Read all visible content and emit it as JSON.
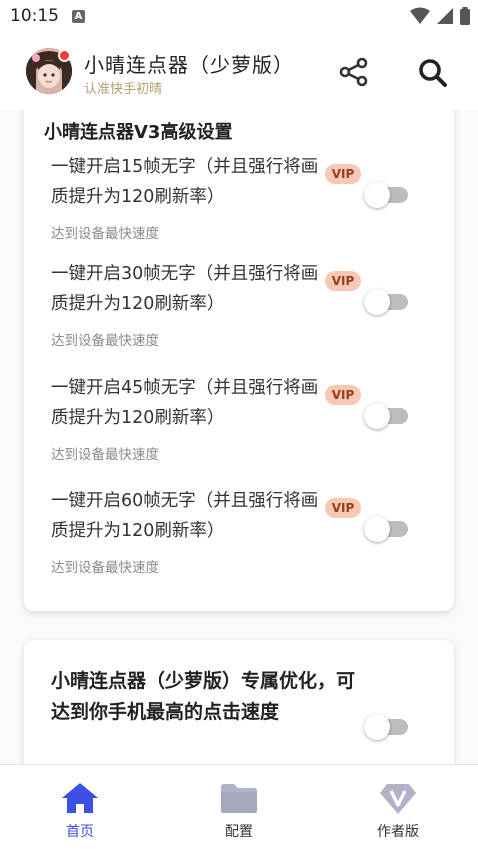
{
  "status_bar": {
    "time": "10:15",
    "notification": "A"
  },
  "header": {
    "title": "小晴连点器（少萝版）",
    "subtitle": "认准快手初晴",
    "share_icon": "share-icon",
    "search_icon": "search-icon"
  },
  "advanced_card": {
    "title": "小晴连点器V3高级设置",
    "options": [
      {
        "label": "一键开启15帧无字（并且强行将画质提升为120刷新率）",
        "sub": "达到设备最快速度",
        "badge": "VIP",
        "enabled": false
      },
      {
        "label": "一键开启30帧无字（并且强行将画质提升为120刷新率）",
        "sub": "达到设备最快速度",
        "badge": "VIP",
        "enabled": false
      },
      {
        "label": "一键开启45帧无字（并且强行将画质提升为120刷新率）",
        "sub": "达到设备最快速度",
        "badge": "VIP",
        "enabled": false
      },
      {
        "label": "一键开启60帧无字（并且强行将画质提升为120刷新率）",
        "sub": "达到设备最快速度",
        "badge": "VIP",
        "enabled": false
      }
    ]
  },
  "optimize_card": {
    "label": "小晴连点器（少萝版）专属优化，可达到你手机最高的点击速度",
    "enabled": false
  },
  "bottom_nav": {
    "items": [
      {
        "label": "首页",
        "icon": "home-icon",
        "active": true
      },
      {
        "label": "配置",
        "icon": "folder-icon",
        "active": false
      },
      {
        "label": "作者版",
        "icon": "diamond-v-icon",
        "active": false
      }
    ]
  },
  "colors": {
    "accent": "#3a50e6",
    "vip_bg": "#f7c8b4",
    "vip_text": "#9a3d1c",
    "subtitle": "#b3a06f"
  }
}
